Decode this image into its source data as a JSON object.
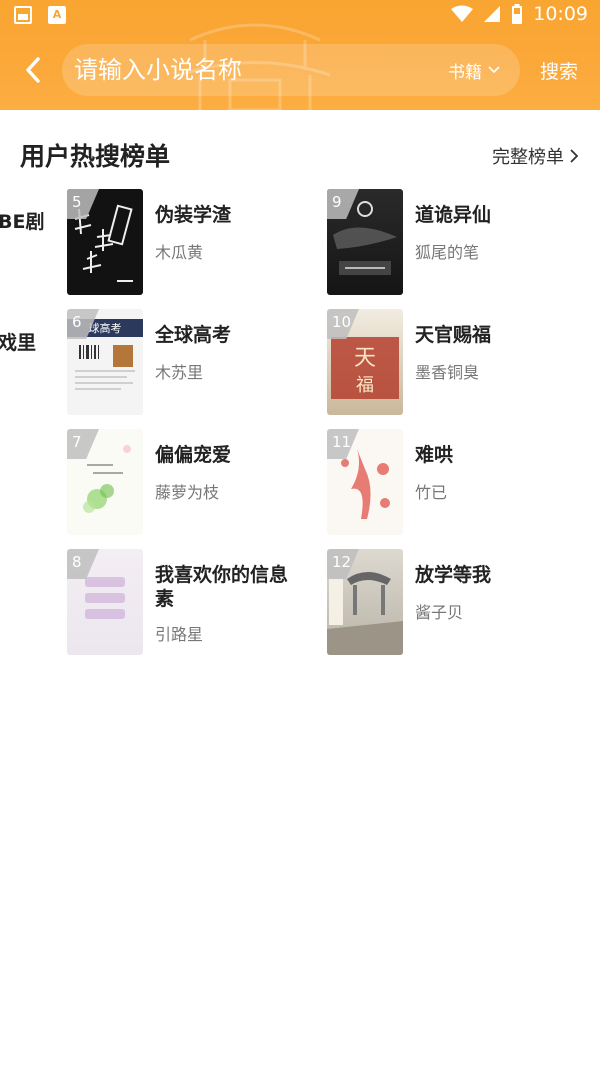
{
  "status_bar": {
    "time": "10:09"
  },
  "header": {
    "search_placeholder": "请输入小说名称",
    "category": "书籍",
    "search_button": "搜索"
  },
  "hot_list": {
    "title": "用户热搜榜单",
    "full_list_link": "完整榜单",
    "partial_left_items": [
      "BE剧",
      "戏里"
    ],
    "books": [
      {
        "rank": "5",
        "title": "伪装学渣",
        "author": "木瓜黄"
      },
      {
        "rank": "9",
        "title": "道诡异仙",
        "author": "狐尾的笔"
      },
      {
        "rank": "6",
        "title": "全球高考",
        "author": "木苏里"
      },
      {
        "rank": "10",
        "title": "天官赐福",
        "author": "墨香铜臭"
      },
      {
        "rank": "7",
        "title": "偏偏宠爱",
        "author": "藤萝为枝"
      },
      {
        "rank": "11",
        "title": "难哄",
        "author": "竹已"
      },
      {
        "rank": "8",
        "title": "我喜欢你的信息素",
        "author": "引路星"
      },
      {
        "rank": "12",
        "title": "放学等我",
        "author": "酱子贝"
      }
    ]
  },
  "colors": {
    "header_orange": "#f9a531",
    "text_dark": "#222222",
    "text_gray": "#777777"
  }
}
